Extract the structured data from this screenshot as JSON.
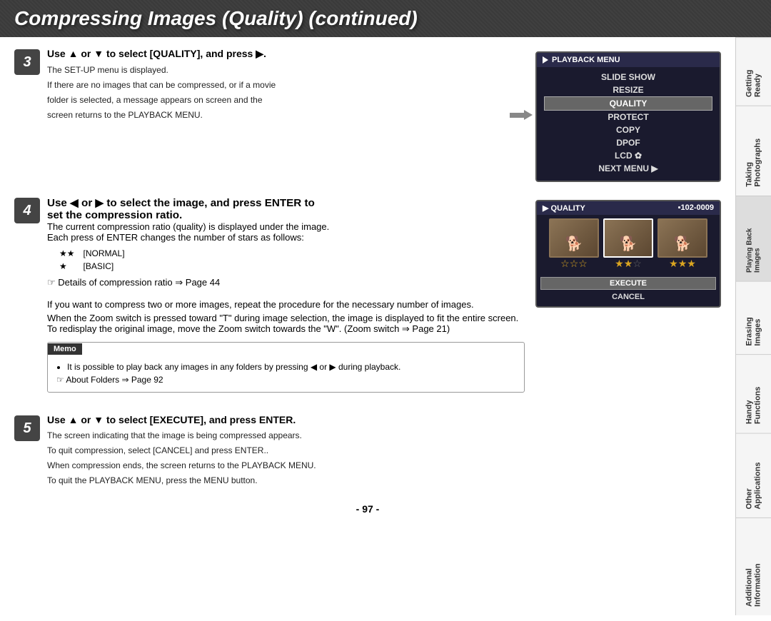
{
  "header": {
    "title": "Compressing Images (Quality) (continued)"
  },
  "sidebar": {
    "tabs": [
      {
        "id": "getting-ready",
        "label": "Getting Ready"
      },
      {
        "id": "taking-photos",
        "label": "Taking Photographs"
      },
      {
        "id": "playing-back",
        "label": "Playing Back Images"
      },
      {
        "id": "erasing",
        "label": "Erasing Images"
      },
      {
        "id": "handy-functions",
        "label": "Handy Functions"
      },
      {
        "id": "other-apps",
        "label": "Other Applications"
      },
      {
        "id": "additional-info",
        "label": "Additional Information"
      }
    ]
  },
  "step3": {
    "number": "3",
    "heading": "Use ▲ or ▼ to select [QUALITY], and press ▶.",
    "lines": [
      "The SET-UP menu is displayed.",
      "If there are no images that can be compressed, or if a movie",
      "folder is selected, a message appears on screen and the",
      "screen returns to the PLAYBACK MENU."
    ],
    "menu": {
      "title": "PLAYBACK MENU",
      "items": [
        "SLIDE SHOW",
        "RESIZE",
        "QUALITY",
        "PROTECT",
        "COPY",
        "DPOF",
        "LCD ✿",
        "NEXT MENU ▶"
      ]
    }
  },
  "step4": {
    "number": "4",
    "heading": "Use ◀ or ▶ to select the image, and press ENTER to set the compression ratio.",
    "lines": [
      "The current compression ratio (quality) is displayed under the image.",
      "Each press of ENTER changes the number of stars as follows:"
    ],
    "stars": [
      {
        "symbol": "★★",
        "label": "[NORMAL]"
      },
      {
        "symbol": "★",
        "label": "[BASIC]"
      }
    ],
    "details_note": "☞ Details of compression ratio ⇒ Page 44",
    "extra_lines": [
      "If you want to compress two or more images, repeat the procedure for the necessary number of images.",
      "When the Zoom switch is pressed toward \"T\" during image selection, the image is displayed to fit the entire screen. To redisplay the original image, move the Zoom switch towards the \"W\". (Zoom switch ⇒ Page 21)"
    ],
    "quality_screen": {
      "header_left": "▶ QUALITY",
      "header_right": "▪102-0009",
      "images": [
        "dog1",
        "dog2",
        "dog3"
      ],
      "stars_row": [
        "☆☆☆",
        "★★☆",
        "★★★"
      ],
      "execute": "EXECUTE",
      "cancel": "CANCEL"
    }
  },
  "memo": {
    "label": "Memo",
    "items": [
      "It is possible to play back any images in any folders by pressing ◀ or ▶ during playback.",
      "☞ About Folders ⇒ Page 92"
    ]
  },
  "step5": {
    "number": "5",
    "heading": "Use ▲ or ▼ to select [EXECUTE], and press ENTER.",
    "lines": [
      "The screen indicating that the image is being compressed appears.",
      "To quit compression, select [CANCEL] and press ENTER..",
      "When compression ends, the screen returns to the PLAYBACK MENU.",
      "To quit the PLAYBACK MENU, press the MENU button."
    ]
  },
  "page_number": "- 97 -"
}
